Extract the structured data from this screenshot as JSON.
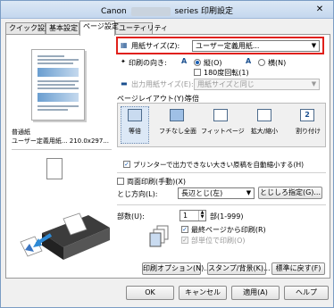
{
  "window": {
    "title_left": "Canon",
    "title_right": "series 印刷設定",
    "close": "✕"
  },
  "tabs": [
    "クイック設定",
    "基本設定",
    "ページ設定",
    "ユーティリティ"
  ],
  "preview": {
    "media_line1": "普通紙",
    "media_line2": "ユーザー定義用紙... 210.0x297..."
  },
  "paper_size": {
    "label": "用紙サイズ(Z):",
    "value": "ユーザー定義用紙..."
  },
  "orientation": {
    "label": "印刷の向き:",
    "portrait": "縦(O)",
    "landscape": "横(N)",
    "rotate180": "180度回転(1)",
    "selected": "portrait"
  },
  "output_size": {
    "label": "出力用紙サイズ(E):",
    "value": "用紙サイズと同じ"
  },
  "page_layout": {
    "label": "ページレイアウト(Y):",
    "value": "等倍",
    "options": [
      "等倍",
      "フチなし全面",
      "フィットページ",
      "拡大/縮小",
      "割り付け"
    ],
    "selected": 0
  },
  "auto_reduce": {
    "label": "プリンターで出力できない大きい原稿を自動縮小する(H)",
    "checked": true
  },
  "duplex": {
    "label": "両面印刷(手動)(X)",
    "checked": false
  },
  "binding": {
    "label": "とじ方向(L):",
    "value": "長辺とじ(左)",
    "button": "とじしろ指定(G)..."
  },
  "copies": {
    "label": "部数(U):",
    "value": "1",
    "range": "部(1-999)",
    "reverse": "最終ページから印刷(R)",
    "collate": "部単位で印刷(O)",
    "reverse_checked": true,
    "collate_checked": true
  },
  "buttons": {
    "print_options": "印刷オプション(N)...",
    "stamp": "スタンプ/背景(K)...",
    "defaults": "標準に戻す(F)"
  },
  "footer": {
    "ok": "OK",
    "cancel": "キャンセル",
    "apply": "適用(A)",
    "help": "ヘルプ"
  }
}
